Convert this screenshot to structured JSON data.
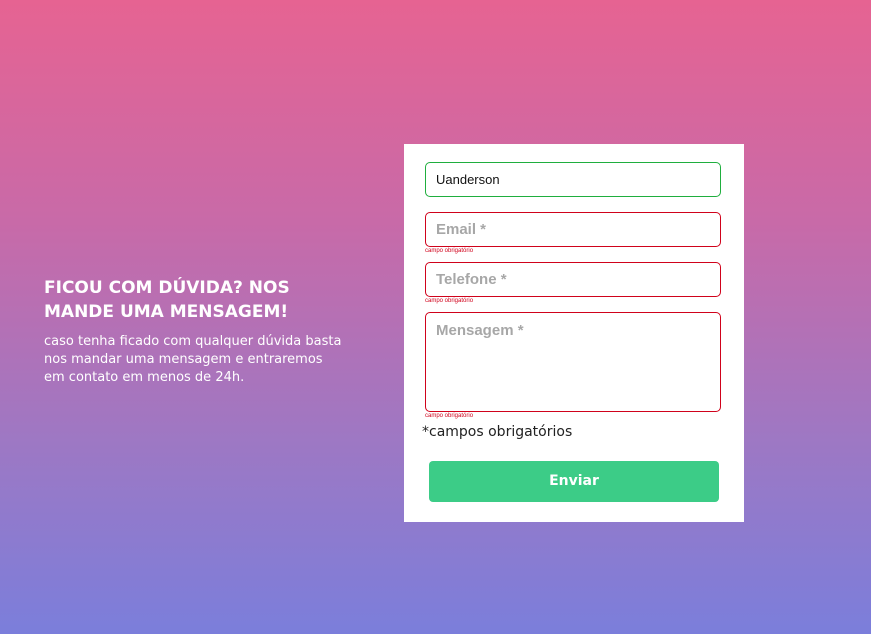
{
  "info": {
    "heading": "FICOU COM DÚVIDA? NOS MANDE UMA MENSAGEM!",
    "text": "caso tenha ficado com qualquer dúvida basta nos mandar uma mensagem e entraremos em contato em menos de 24h."
  },
  "form": {
    "name": {
      "value": "Uanderson",
      "status": "valid"
    },
    "email": {
      "placeholder": "Email *",
      "error": "campo obrigatório"
    },
    "phone": {
      "placeholder": "Telefone *",
      "error": "campo obrigatório"
    },
    "message": {
      "placeholder": "Mensagem *",
      "error": "campo obrigatório"
    },
    "required_note": "*campos obrigatórios",
    "submit_label": "Enviar"
  },
  "colors": {
    "gradient_top": "#e66392",
    "gradient_bottom": "#7b7edb",
    "valid_border": "#1fae3e",
    "error_border": "#d0021b",
    "submit_bg": "#3ccc87"
  }
}
